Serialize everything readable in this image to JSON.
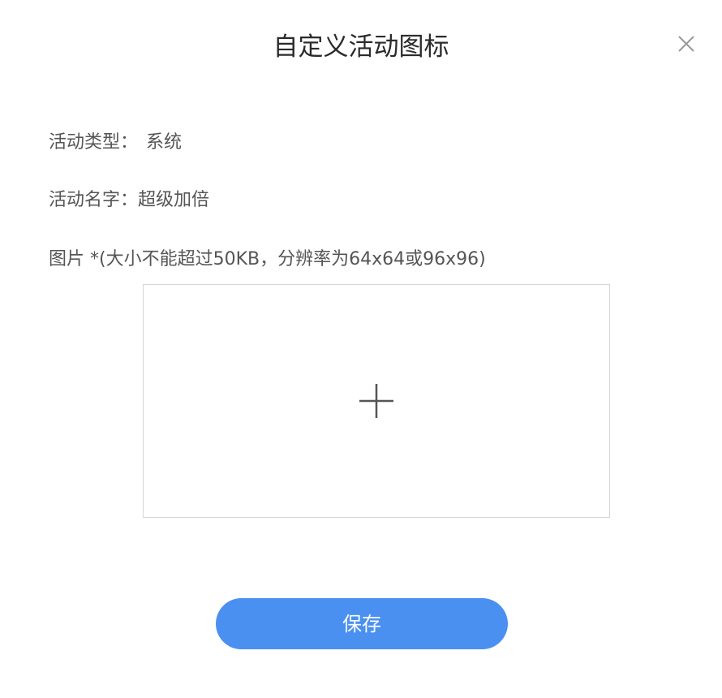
{
  "dialog": {
    "title": "自定义活动图标",
    "close_icon": "close-icon"
  },
  "fields": {
    "activity_type_label": "活动类型：",
    "activity_type_value": "系统",
    "activity_name_label": "活动名字：",
    "activity_name_value": "超级加倍",
    "image_label": "图片 *(大小不能超过50KB，分辨率为64x64或96x96)"
  },
  "upload": {
    "icon": "plus-icon"
  },
  "actions": {
    "save_label": "保存"
  },
  "colors": {
    "primary_button": "#4a90f0",
    "border": "#d6d6d6",
    "text": "#555555",
    "title": "#2b2b2b"
  }
}
